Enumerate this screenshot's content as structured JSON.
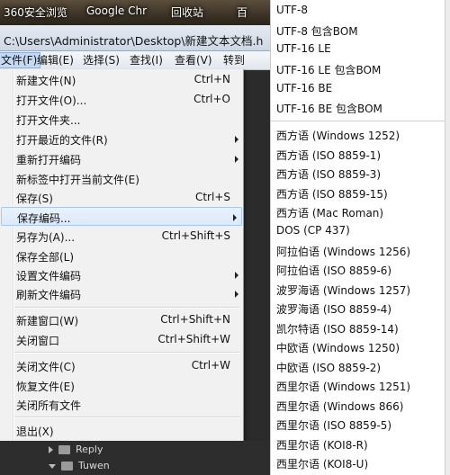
{
  "taskbar": {
    "items": [
      "360安全浏览",
      "Google Chr",
      "回收站",
      "百"
    ]
  },
  "window": {
    "title": "C:\\Users\\Administrator\\Desktop\\新建文本文档.h"
  },
  "menubar": {
    "items": [
      "文件(F)",
      "编辑(E)",
      "选择(S)",
      "查找(I)",
      "查看(V)",
      "转到"
    ]
  },
  "file_menu": {
    "items": [
      {
        "label": "新建文件(N)",
        "shortcut": "Ctrl+N"
      },
      {
        "label": "打开文件(O)...",
        "shortcut": "Ctrl+O"
      },
      {
        "label": "打开文件夹..."
      },
      {
        "label": "打开最近的文件(R)",
        "submenu": true
      },
      {
        "label": "重新打开编码",
        "submenu": true
      },
      {
        "label": "新标签中打开当前文件(E)"
      },
      {
        "label": "保存(S)",
        "shortcut": "Ctrl+S"
      },
      {
        "label": "保存编码...",
        "submenu": true,
        "highlighted": true
      },
      {
        "label": "另存为(A)...",
        "shortcut": "Ctrl+Shift+S"
      },
      {
        "label": "保存全部(L)"
      },
      {
        "label": "设置文件编码",
        "submenu": true
      },
      {
        "label": "刷新文件编码",
        "submenu": true
      },
      {
        "label": "新建窗口(W)",
        "shortcut": "Ctrl+Shift+N"
      },
      {
        "label": "关闭窗口",
        "shortcut": "Ctrl+Shift+W"
      },
      {
        "label": "关闭文件(C)",
        "shortcut": "Ctrl+W"
      },
      {
        "label": "恢复文件(E)"
      },
      {
        "label": "关闭所有文件"
      },
      {
        "label": "退出(X)"
      }
    ]
  },
  "tree": {
    "items": [
      "Reply",
      "Tuwen"
    ]
  },
  "encodings": [
    "UTF-8",
    "UTF-8 包含BOM",
    "UTF-16 LE",
    "UTF-16 LE 包含BOM",
    "UTF-16 BE",
    "UTF-16 BE 包含BOM",
    "西方语 (Windows 1252)",
    "西方语 (ISO 8859-1)",
    "西方语 (ISO 8859-3)",
    "西方语 (ISO 8859-15)",
    "西方语 (Mac Roman)",
    "DOS (CP 437)",
    "阿拉伯语 (Windows 1256)",
    "阿拉伯语 (ISO 8859-6)",
    "波罗海语 (Windows 1257)",
    "波罗海语 (ISO 8859-4)",
    "凯尔特语 (ISO 8859-14)",
    "中欧语 (Windows 1250)",
    "中欧语 (ISO 8859-2)",
    "西里尔语 (Windows 1251)",
    "西里尔语 (Windows 866)",
    "西里尔语 (ISO 8859-5)",
    "西里尔语 (KOI8-R)",
    "西里尔语 (KOI8-U)"
  ]
}
